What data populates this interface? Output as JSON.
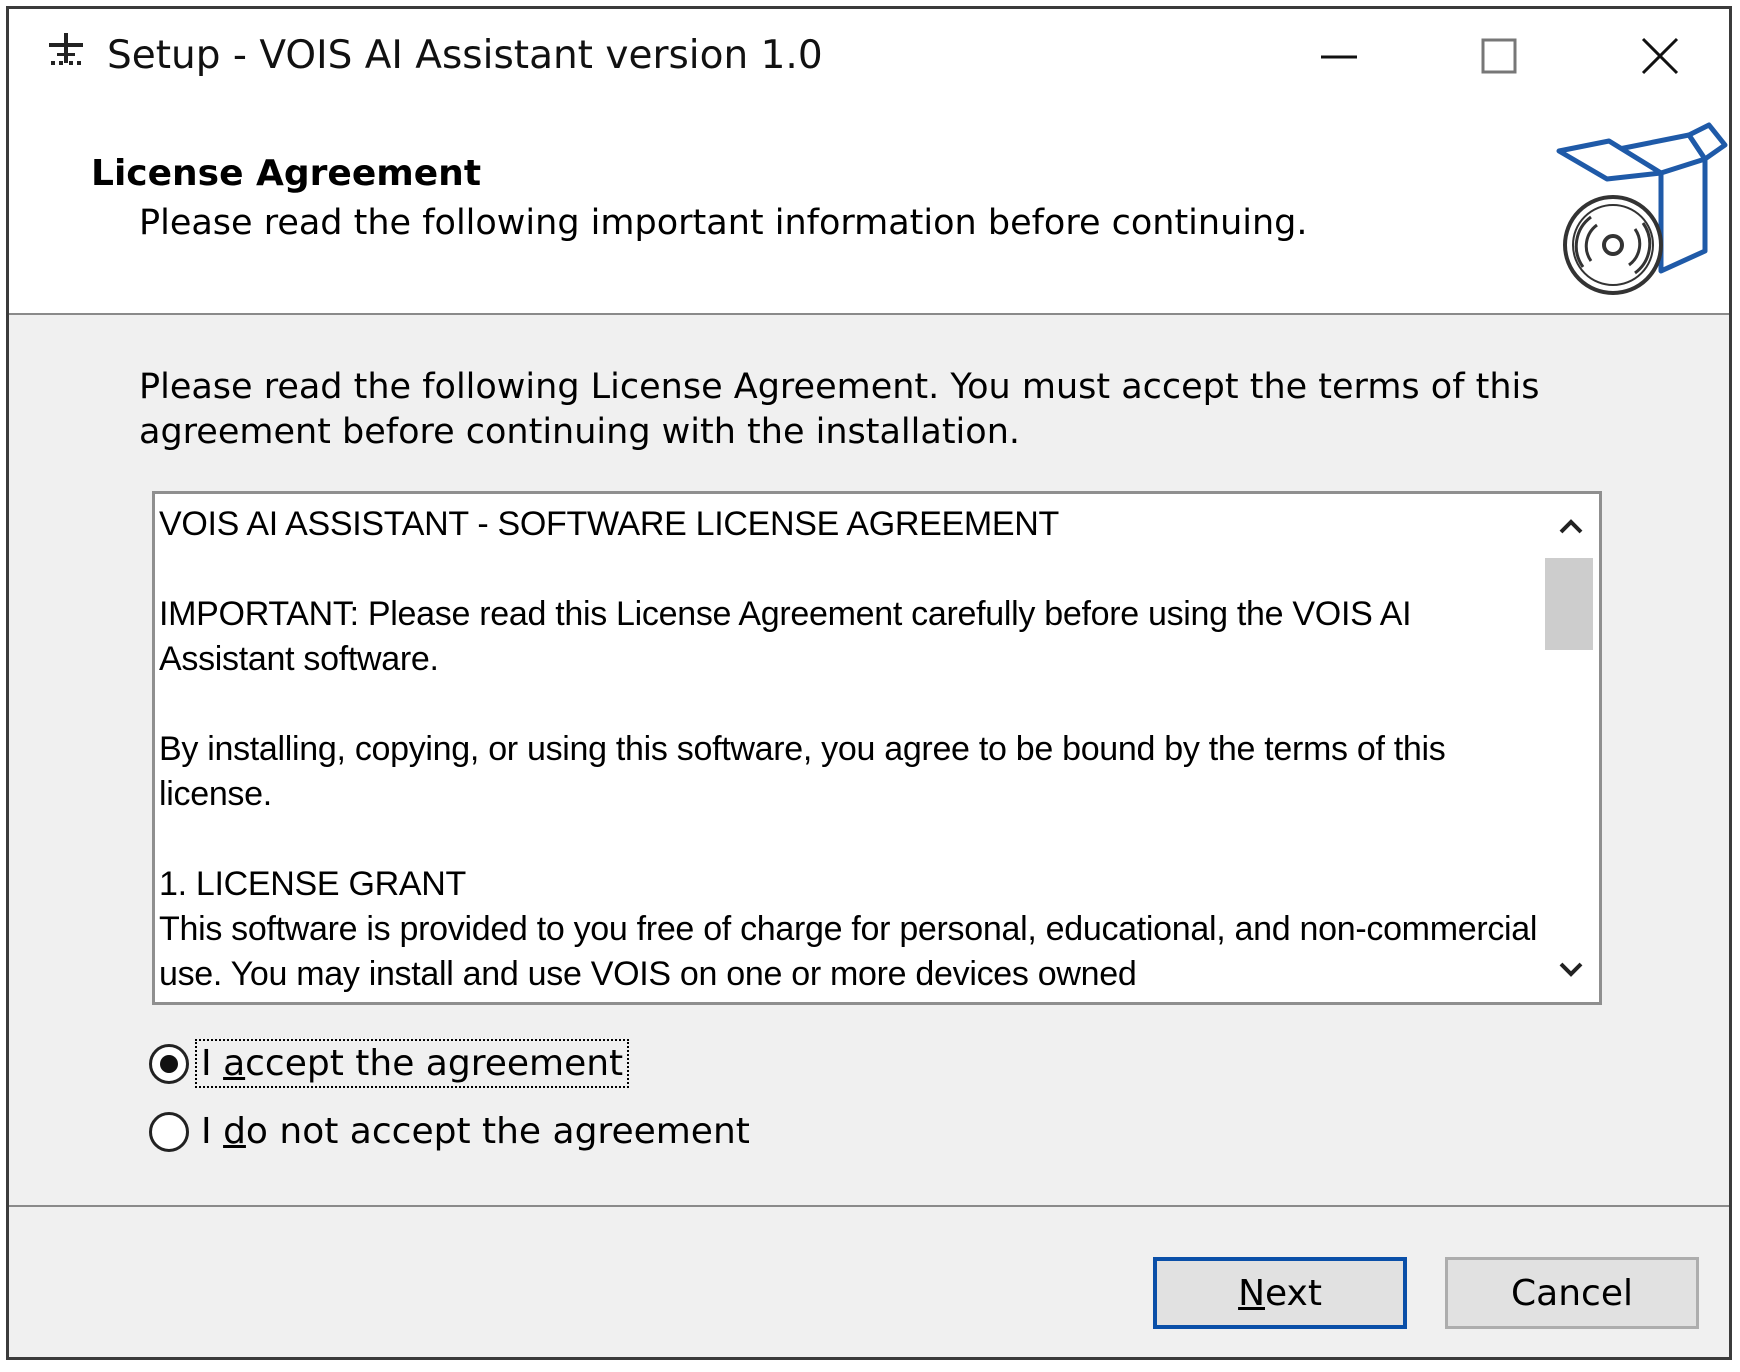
{
  "window": {
    "title": "Setup - VOIS AI Assistant version 1.0"
  },
  "header": {
    "title": "License Agreement",
    "subtitle": "Please read the following important information before continuing."
  },
  "main": {
    "intro": "Please read the following License Agreement. You must accept the terms of this agreement before continuing with the installation.",
    "license_text": "VOIS AI ASSISTANT - SOFTWARE LICENSE AGREEMENT\n\nIMPORTANT: Please read this License Agreement carefully before using the VOIS AI Assistant software.\n\nBy installing, copying, or using this software, you agree to be bound by the terms of this license.\n\n1. LICENSE GRANT\nThis software is provided to you free of charge for personal, educational, and non-commercial use. You may install and use VOIS on one or more devices owned",
    "options": [
      {
        "label_pre": "I ",
        "label_access": "a",
        "label_post": "ccept the agreement",
        "selected": true
      },
      {
        "label_pre": "I ",
        "label_access": "d",
        "label_post": "o not accept the agreement",
        "selected": false
      }
    ]
  },
  "footer": {
    "next_access": "N",
    "next_rest": "ext",
    "cancel_label": "Cancel"
  },
  "icons": {
    "app": "setup-icon",
    "header": "installer-box-icon"
  },
  "colors": {
    "accent": "#0a4fa8",
    "panel": "#f0f0f0"
  }
}
